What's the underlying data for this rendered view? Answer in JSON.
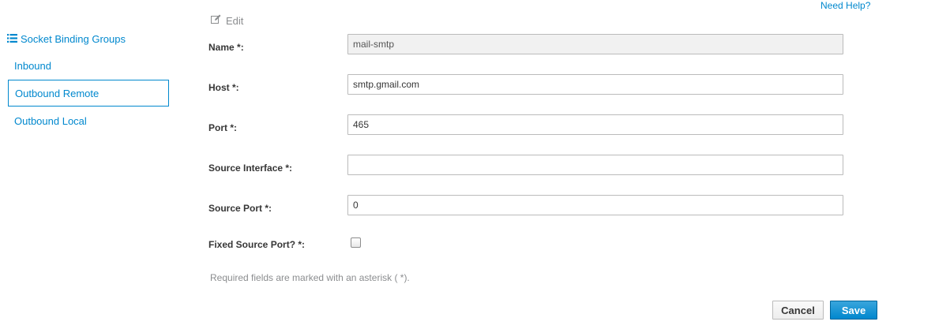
{
  "sidebar": {
    "header": "Socket Binding Groups",
    "items": [
      {
        "label": "Inbound",
        "active": false
      },
      {
        "label": "Outbound Remote",
        "active": true
      },
      {
        "label": "Outbound Local",
        "active": false
      }
    ]
  },
  "toolbar": {
    "edit_label": "Edit",
    "help_label": "Need Help?"
  },
  "form": {
    "name": {
      "label": "Name *:",
      "value": "mail-smtp",
      "readonly": true
    },
    "host": {
      "label": "Host *:",
      "value": "smtp.gmail.com"
    },
    "port": {
      "label": "Port *:",
      "value": "465"
    },
    "source_interface": {
      "label": "Source Interface *:",
      "value": ""
    },
    "source_port": {
      "label": "Source Port *:",
      "value": "0"
    },
    "fixed_source_port": {
      "label": "Fixed Source Port? *:",
      "checked": false
    },
    "required_note": "Required fields are marked with an asterisk ( *)."
  },
  "buttons": {
    "cancel_label": "Cancel",
    "save_label": "Save"
  },
  "colors": {
    "accent": "#0088ce",
    "save_button": "#0088ce",
    "readonly_field": "#f1f1f1"
  },
  "icons": {
    "sidebar_header": "list-icon",
    "edit": "pencil-icon"
  }
}
